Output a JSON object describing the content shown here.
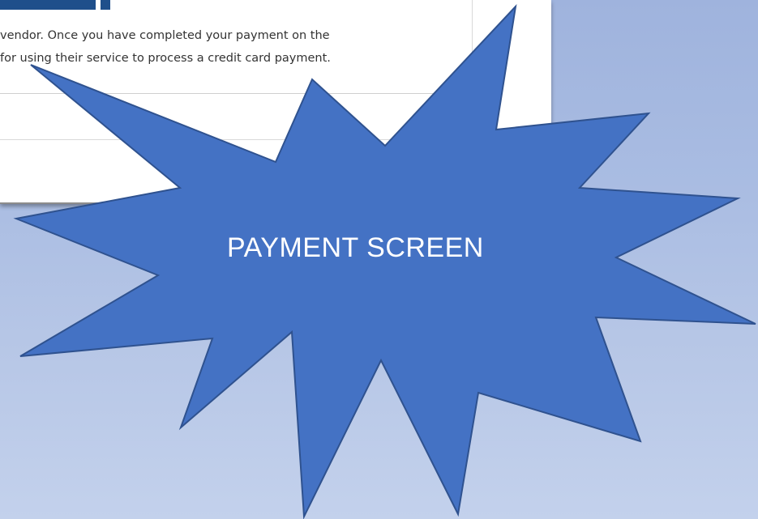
{
  "dialog": {
    "message_line_1": "vendor. Once you have completed your payment on the",
    "message_line_2": "for using their service to process a credit card payment."
  },
  "callout": {
    "label": "PAYMENT SCREEN",
    "fill_color": "#4472c4",
    "stroke_color": "#2f528f",
    "text_color": "#ffffff"
  },
  "background": {
    "gradient_top": "#9fb3dd",
    "gradient_bottom": "#c3d1ec"
  }
}
